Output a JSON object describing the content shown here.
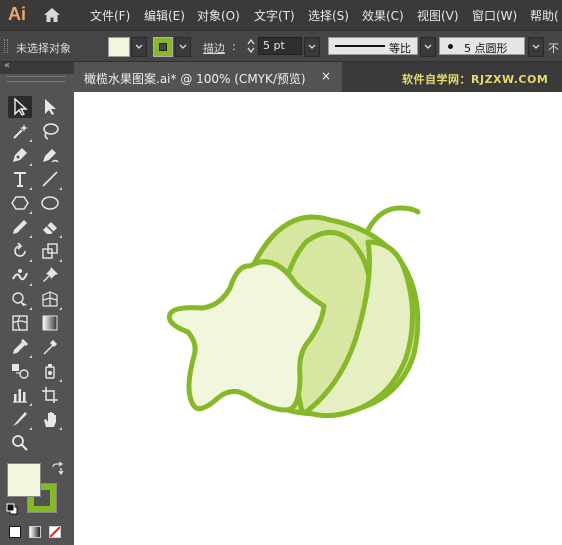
{
  "app": {
    "logo": "Ai"
  },
  "menubar": {
    "items": [
      {
        "label": "文件(F)"
      },
      {
        "label": "编辑(E)"
      },
      {
        "label": "对象(O)"
      },
      {
        "label": "文字(T)"
      },
      {
        "label": "选择(S)"
      },
      {
        "label": "效果(C)"
      },
      {
        "label": "视图(V)"
      },
      {
        "label": "窗口(W)"
      },
      {
        "label": "帮助("
      }
    ]
  },
  "control_bar": {
    "selection_status": "未选择对象",
    "fill_color": "#f1f6dd",
    "stroke_color": "#86b92a",
    "stroke_label": "描边",
    "stroke_weight": "5 pt",
    "profile_label": "等比",
    "brush_label": "5 点圆形",
    "opacity_label": "不"
  },
  "document_tab": {
    "title": "橄榄水果图案.ai* @ 100% (CMYK/预览)",
    "close": "×"
  },
  "watermark": "软件自学网：RJZXW.COM",
  "tools_panel": {
    "collapse_glyph": "«",
    "tools": [
      {
        "name": "selection-tool",
        "selected": true
      },
      {
        "name": "direct-selection-tool"
      },
      {
        "name": "magic-wand-tool"
      },
      {
        "name": "lasso-tool"
      },
      {
        "name": "pen-tool"
      },
      {
        "name": "curvature-tool"
      },
      {
        "name": "type-tool"
      },
      {
        "name": "line-segment-tool"
      },
      {
        "name": "polygon-tool"
      },
      {
        "name": "ellipse-tool"
      },
      {
        "name": "pencil-tool"
      },
      {
        "name": "eraser-tool"
      },
      {
        "name": "rotate-tool"
      },
      {
        "name": "scale-tool"
      },
      {
        "name": "puppet-warp-tool"
      },
      {
        "name": "pin-tool"
      },
      {
        "name": "shape-builder-tool"
      },
      {
        "name": "perspective-grid-tool"
      },
      {
        "name": "mesh-tool"
      },
      {
        "name": "gradient-tool"
      },
      {
        "name": "eyedropper-tool"
      },
      {
        "name": "measure-tool"
      },
      {
        "name": "blend-tool"
      },
      {
        "name": "symbol-sprayer-tool"
      },
      {
        "name": "column-graph-tool"
      },
      {
        "name": "artboard-tool"
      },
      {
        "name": "slice-tool"
      },
      {
        "name": "hand-tool"
      },
      {
        "name": "zoom-tool"
      }
    ],
    "fill_color": "#f1f6dd",
    "stroke_color": "#86b92a"
  },
  "artwork": {
    "outline_color": "#86b92a",
    "star_fill": "#f1f6dd",
    "body_fill": "#d7e6a0",
    "body_fill_light": "#e6efc2"
  }
}
